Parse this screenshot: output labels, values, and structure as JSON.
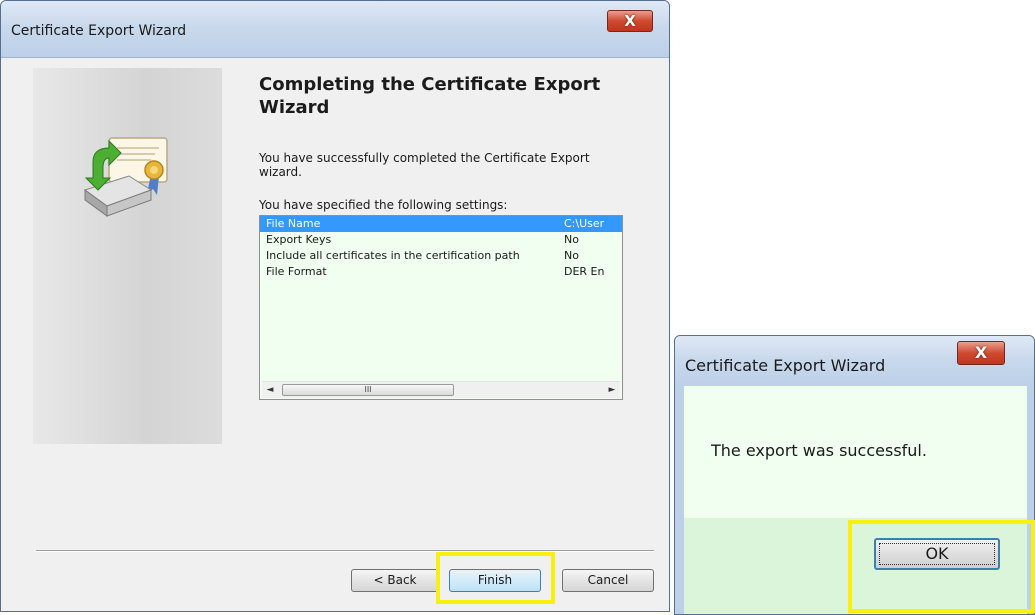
{
  "wizard": {
    "title": "Certificate Export Wizard",
    "close_label": "X",
    "heading": "Completing the Certificate Export Wizard",
    "message": "You have successfully completed the Certificate Export wizard.",
    "settings_label": "You have specified the following settings:",
    "settings": [
      {
        "name": "File Name",
        "value": "C:\\User"
      },
      {
        "name": "Export Keys",
        "value": "No"
      },
      {
        "name": "Include all certificates in the certification path",
        "value": "No"
      },
      {
        "name": "File Format",
        "value": "DER En"
      }
    ],
    "scroll_left": "◄",
    "scroll_right": "►",
    "scroll_thumb_grip": "III",
    "buttons": {
      "back": "< Back",
      "finish": "Finish",
      "cancel": "Cancel"
    }
  },
  "confirm": {
    "title": "Certificate Export Wizard",
    "close_label": "X",
    "message": "The export was successful.",
    "ok_label": "OK"
  },
  "colors": {
    "highlight": "#f9ef12",
    "selection": "#3399ff",
    "list_background": "#f0fff0"
  }
}
